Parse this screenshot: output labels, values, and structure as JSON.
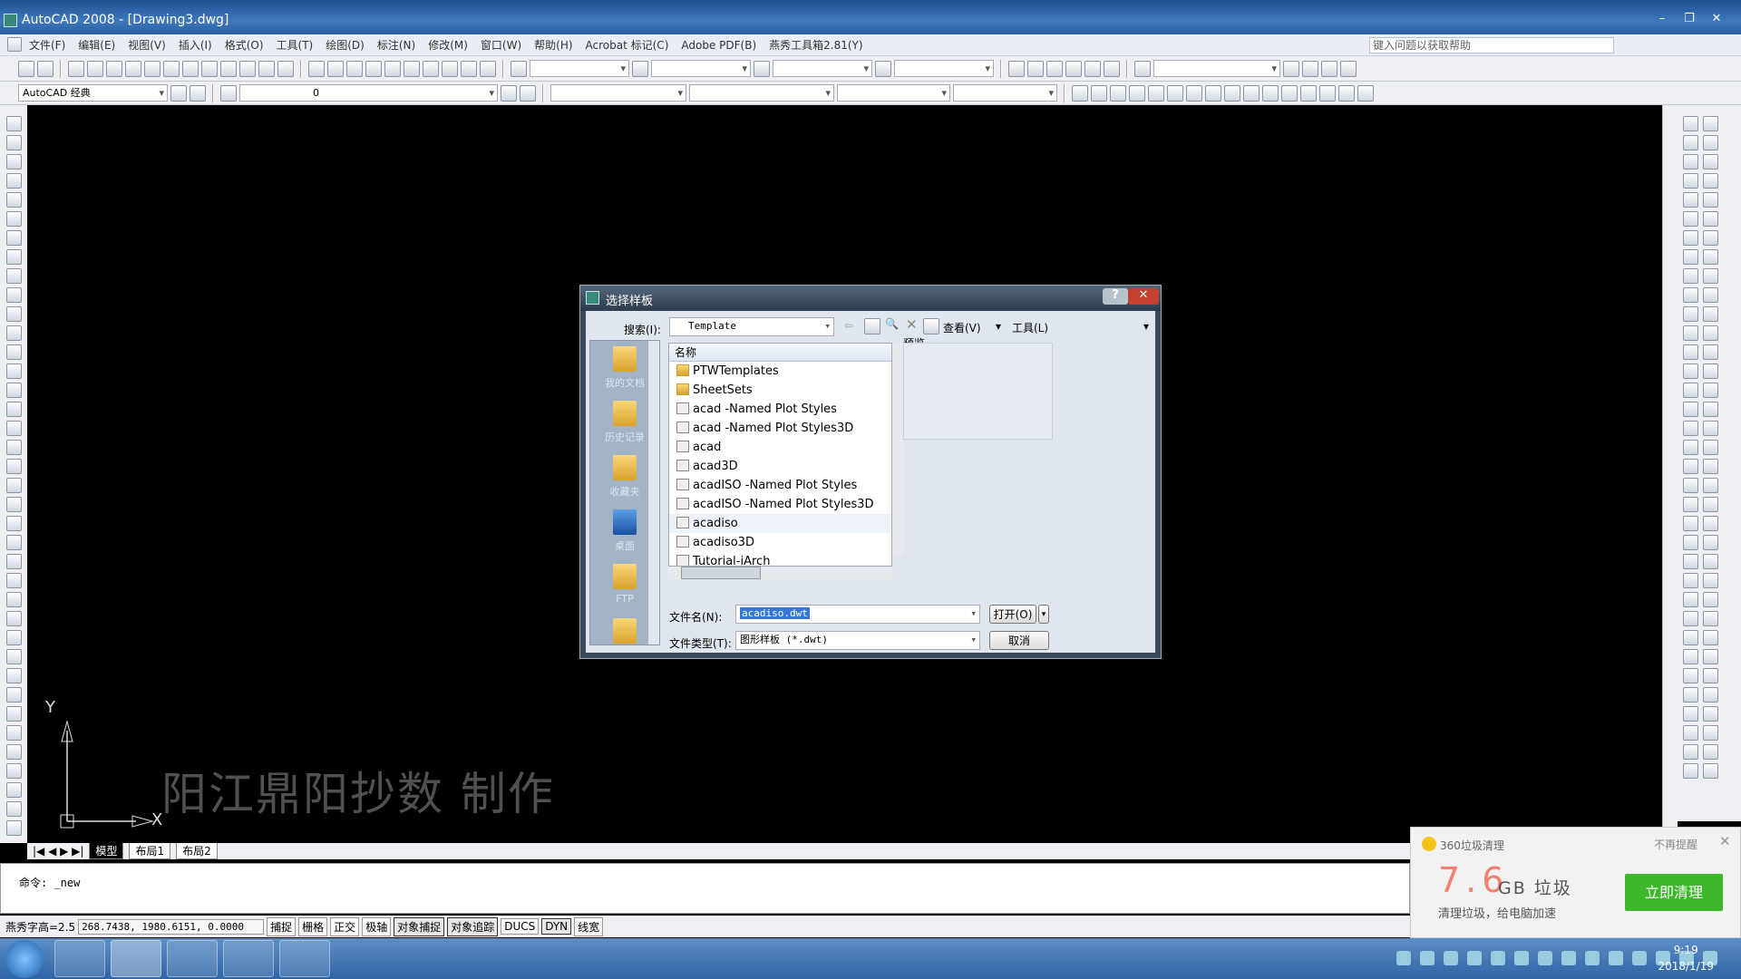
{
  "window": {
    "title": "AutoCAD 2008 - [Drawing3.dwg]",
    "controls": [
      "–",
      "❐",
      "✕"
    ]
  },
  "menu": [
    "文件(F)",
    "编辑(E)",
    "视图(V)",
    "插入(I)",
    "格式(O)",
    "工具(T)",
    "绘图(D)",
    "标注(N)",
    "修改(M)",
    "窗口(W)",
    "帮助(H)",
    "Acrobat 标记(C)",
    "Adobe PDF(B)",
    "燕秀工具箱2.81(Y)"
  ],
  "help_placeholder": "键入问题以获取帮助",
  "workspace": "AutoCAD 经典",
  "layer_value": "0",
  "canvas": {
    "watermark": "阳江鼎阳抄数 制作",
    "ucs_x": "X",
    "ucs_y": "Y"
  },
  "tabs": [
    "模型",
    "布局1",
    "布局2"
  ],
  "command": {
    "line": "命令:  _new"
  },
  "status": {
    "text_height": "燕秀字高=2.5",
    "coords": "268.7438,  1980.6151, 0.0000",
    "toggles": [
      {
        "l": "捕捉",
        "on": false
      },
      {
        "l": "栅格",
        "on": false
      },
      {
        "l": "正交",
        "on": false
      },
      {
        "l": "极轴",
        "on": false
      },
      {
        "l": "对象捕捉",
        "on": true
      },
      {
        "l": "对象追踪",
        "on": true
      },
      {
        "l": "DUCS",
        "on": false
      },
      {
        "l": "DYN",
        "on": true
      },
      {
        "l": "线宽",
        "on": false
      }
    ]
  },
  "dialog": {
    "title": "选择样板",
    "help": "?",
    "close": "✕",
    "lookin_label": "搜索(I):",
    "lookin_value": "Template",
    "view_label": "查看(V)",
    "tools_label": "工具(L)",
    "places": [
      "我的文档",
      "历史记录",
      "收藏夹",
      "桌面",
      "FTP",
      ""
    ],
    "column_name": "名称",
    "preview_label": "预览",
    "files": [
      {
        "n": "PTWTemplates",
        "t": "folder"
      },
      {
        "n": "SheetSets",
        "t": "folder"
      },
      {
        "n": "acad -Named Plot Styles",
        "t": "dwt"
      },
      {
        "n": "acad -Named Plot Styles3D",
        "t": "dwt"
      },
      {
        "n": "acad",
        "t": "dwt"
      },
      {
        "n": "acad3D",
        "t": "dwt"
      },
      {
        "n": "acadISO -Named Plot Styles",
        "t": "dwt"
      },
      {
        "n": "acadISO -Named Plot Styles3D",
        "t": "dwt"
      },
      {
        "n": "acadiso",
        "t": "dwt",
        "sel": true
      },
      {
        "n": "acadiso3D",
        "t": "dwt"
      },
      {
        "n": "Tutorial-iArch",
        "t": "dwt"
      }
    ],
    "filename_label": "文件名(N):",
    "filename_value": "acadiso.dwt",
    "filetype_label": "文件类型(T):",
    "filetype_value": "图形样板 (*.dwt)",
    "open_label": "打开(O)",
    "cancel_label": "取消"
  },
  "popup": {
    "title": "360垃圾清理",
    "dismiss": "不再提醒",
    "amount": "7.6",
    "unit": "GB 垃圾",
    "sub": "清理垃圾，给电脑加速",
    "action": "立即清理",
    "accent": "#f08070",
    "button_color": "#3cb82a"
  },
  "clock": {
    "time": "9:19",
    "date": "2018/1/19"
  }
}
